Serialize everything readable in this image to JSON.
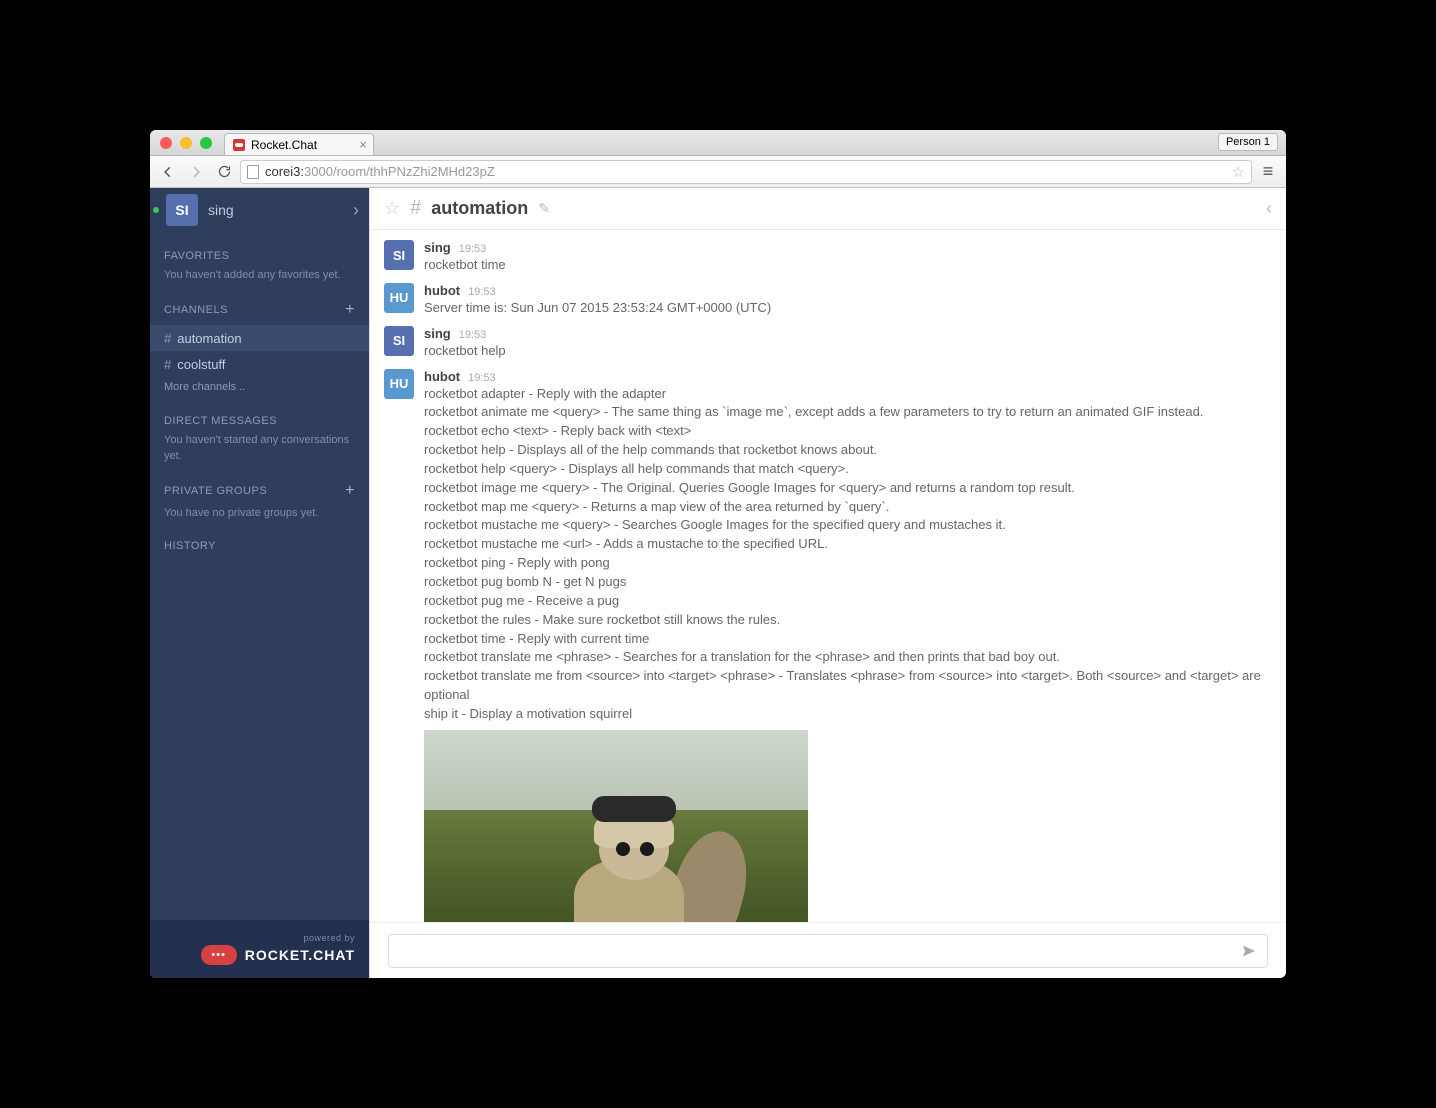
{
  "browser": {
    "tab_title": "Rocket.Chat",
    "profile": "Person 1",
    "url_host": "corei3:",
    "url_path": "3000/room/thhPNzZhi2MHd23pZ"
  },
  "sidebar": {
    "user": {
      "initials": "SI",
      "name": "sing"
    },
    "favorites": {
      "title": "FAVORITES",
      "hint": "You haven't added any favorites yet."
    },
    "channels": {
      "title": "CHANNELS",
      "items": [
        {
          "name": "automation",
          "active": true
        },
        {
          "name": "coolstuff",
          "active": false
        }
      ],
      "more": "More channels .."
    },
    "dm": {
      "title": "DIRECT MESSAGES",
      "hint": "You haven't started any conversations yet."
    },
    "pg": {
      "title": "PRIVATE GROUPS",
      "hint": "You have no private groups yet."
    },
    "history": "HISTORY",
    "footer": {
      "powered": "powered by",
      "brand": "ROCKET.CHAT"
    }
  },
  "room": {
    "name": "automation"
  },
  "messages": [
    {
      "avatar": "SI",
      "cls": "si",
      "name": "sing",
      "time": "19:53",
      "text": "rocketbot time"
    },
    {
      "avatar": "HU",
      "cls": "hu",
      "name": "hubot",
      "time": "19:53",
      "text": "Server time is: Sun Jun 07 2015 23:53:24 GMT+0000 (UTC)"
    },
    {
      "avatar": "SI",
      "cls": "si",
      "name": "sing",
      "time": "19:53",
      "text": "rocketbot help"
    },
    {
      "avatar": "HU",
      "cls": "hu",
      "name": "hubot",
      "time": "19:53",
      "text": "rocketbot adapter - Reply with the adapter\nrocketbot animate me <query> - The same thing as `image me`, except adds a few parameters to try to return an animated GIF instead.\nrocketbot echo <text> - Reply back with <text>\nrocketbot help - Displays all of the help commands that rocketbot knows about.\nrocketbot help <query> - Displays all help commands that match <query>.\nrocketbot image me <query> - The Original. Queries Google Images for <query> and returns a random top result.\nrocketbot map me <query> - Returns a map view of the area returned by `query`.\nrocketbot mustache me <query> - Searches Google Images for the specified query and mustaches it.\nrocketbot mustache me <url> - Adds a mustache to the specified URL.\nrocketbot ping - Reply with pong\nrocketbot pug bomb N - get N pugs\nrocketbot pug me - Receive a pug\nrocketbot the rules - Make sure rocketbot still knows the rules.\nrocketbot time - Reply with current time\nrocketbot translate me <phrase> - Searches for a translation for the <phrase> and then prints that bad boy out.\nrocketbot translate me from <source> into <target> <phrase> - Translates <phrase> from <source> into <target>. Both <source> and <target> are optional\nship it - Display a motivation squirrel",
      "attachment": true
    }
  ],
  "composer": {
    "placeholder": ""
  }
}
